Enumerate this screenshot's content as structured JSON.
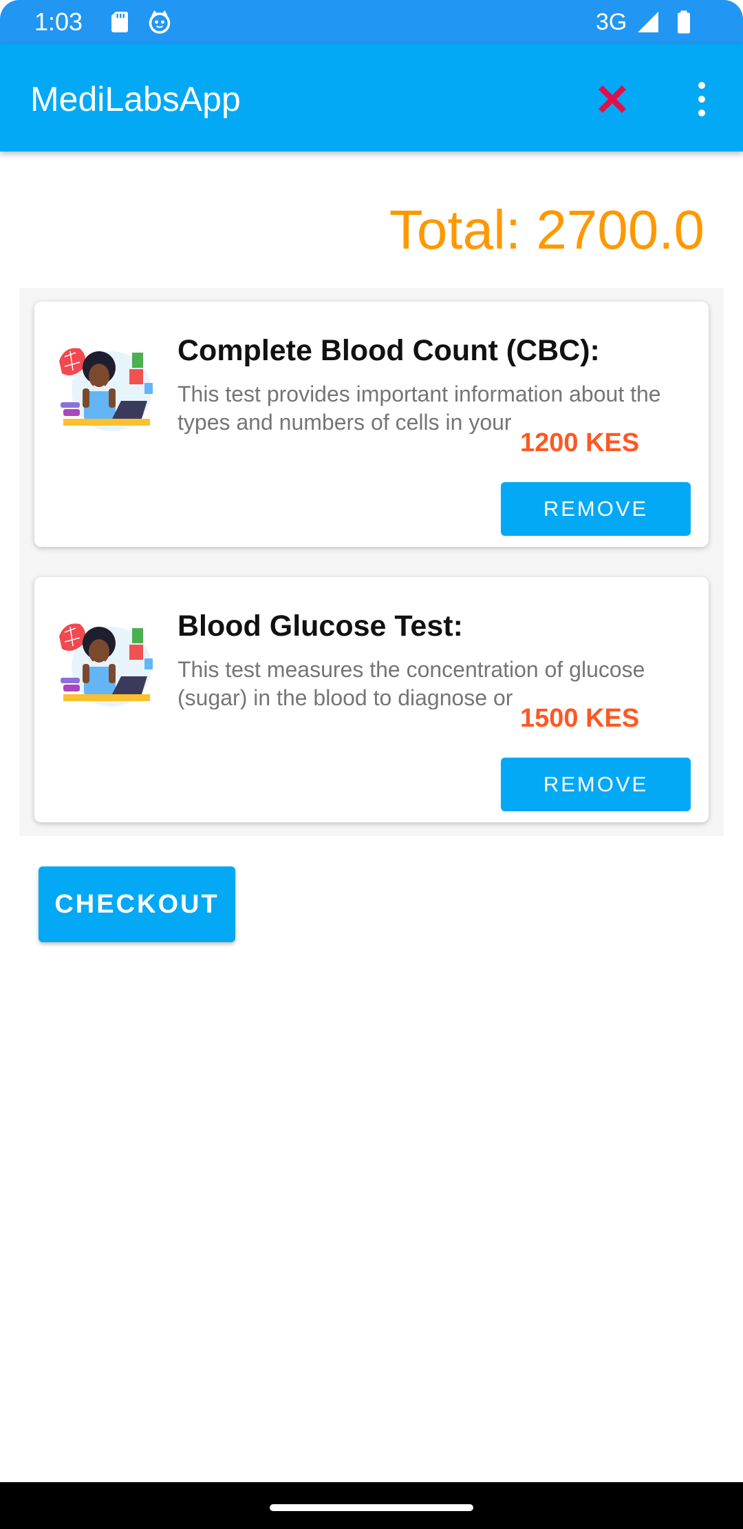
{
  "status_bar": {
    "time": "1:03",
    "network": "3G",
    "icons": [
      "sd-card-icon",
      "cat-face-icon",
      "signal-icon",
      "battery-icon"
    ]
  },
  "app_bar": {
    "title": "MediLabsApp",
    "actions": [
      "close-icon",
      "overflow-menu-icon"
    ],
    "colors": {
      "status_bar": "#2196f3",
      "app_bar": "#03a9f4",
      "close_icon": "#e0114a"
    }
  },
  "cart": {
    "total_text": "Total: 2700.0",
    "total_color": "#ff9800",
    "items": [
      {
        "image": "doctor-with-laptop-illustration",
        "title": "Complete Blood Count (CBC):",
        "description": "This test provides important information about the types and numbers of cells in your",
        "price": "1200 KES",
        "remove_label": "REMOVE"
      },
      {
        "image": "doctor-with-laptop-illustration",
        "title": "Blood Glucose Test:",
        "description": "This test measures the concentration of glucose (sugar) in the blood to diagnose or",
        "price": "1500 KES",
        "remove_label": "REMOVE"
      }
    ],
    "price_color": "#ff5722"
  },
  "checkout": {
    "label": "CHECKOUT"
  }
}
